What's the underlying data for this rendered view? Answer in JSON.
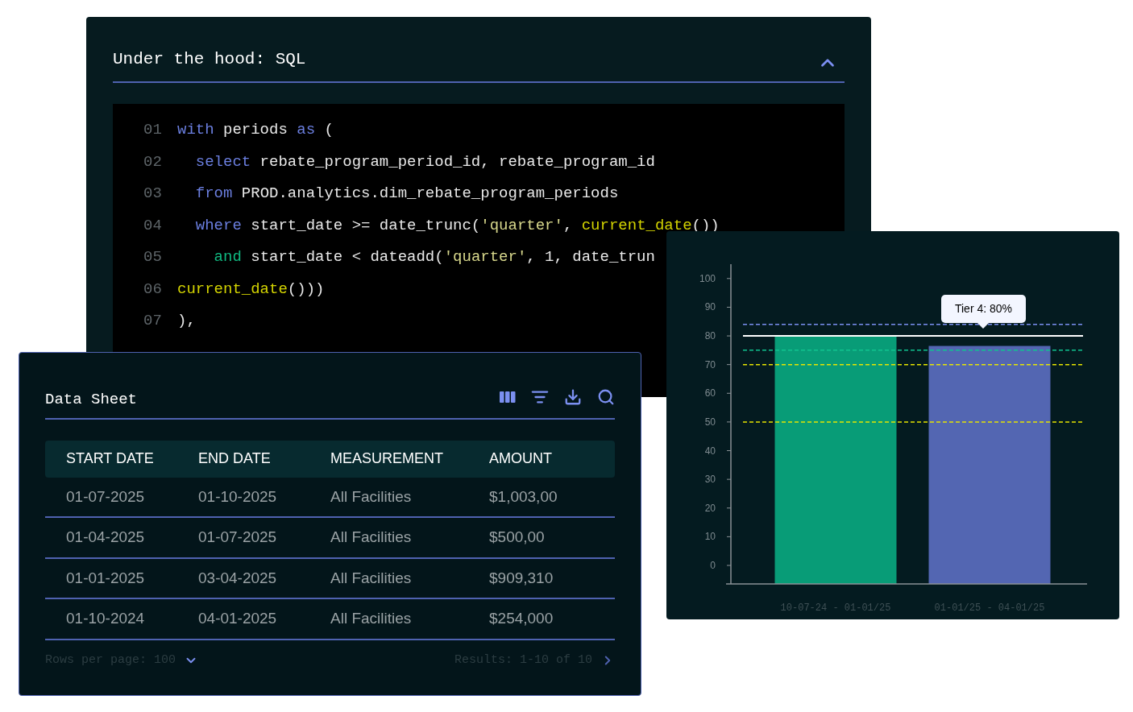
{
  "sql_panel": {
    "title": "Under the hood: SQL",
    "expanded": true,
    "lines": [
      {
        "number": "01",
        "tokens": [
          {
            "kind": "keyword",
            "text": "with"
          },
          {
            "kind": "plain",
            "text": " periods "
          },
          {
            "kind": "keyword",
            "text": "as"
          },
          {
            "kind": "plain",
            "text": " ("
          }
        ]
      },
      {
        "number": "02",
        "tokens": [
          {
            "kind": "keyword",
            "text": "  select"
          },
          {
            "kind": "plain",
            "text": " rebate_program_period_id, rebate_program_id"
          }
        ]
      },
      {
        "number": "03",
        "tokens": [
          {
            "kind": "keyword",
            "text": "  from"
          },
          {
            "kind": "plain",
            "text": " PROD.analytics.dim_rebate_program_periods"
          }
        ]
      },
      {
        "number": "04",
        "tokens": [
          {
            "kind": "keyword",
            "text": "  where"
          },
          {
            "kind": "plain",
            "text": " start_date >= date_trunc("
          },
          {
            "kind": "string",
            "text": "'quarter'"
          },
          {
            "kind": "plain",
            "text": ", "
          },
          {
            "kind": "function",
            "text": "current_date"
          },
          {
            "kind": "plain",
            "text": "())"
          }
        ]
      },
      {
        "number": "05",
        "tokens": [
          {
            "kind": "operator",
            "text": "    and"
          },
          {
            "kind": "plain",
            "text": " start_date < dateadd("
          },
          {
            "kind": "string",
            "text": "'quarter'"
          },
          {
            "kind": "plain",
            "text": ", 1, date_trun"
          }
        ]
      },
      {
        "number": "06",
        "tokens": [
          {
            "kind": "function",
            "text": "current_date"
          },
          {
            "kind": "plain",
            "text": "()))"
          }
        ]
      },
      {
        "number": "07",
        "tokens": [
          {
            "kind": "plain",
            "text": "),"
          }
        ]
      }
    ]
  },
  "chart_panel": {
    "tooltip": "Tier 4: 80%",
    "chart_data": {
      "type": "bar",
      "categories": [
        "10-07-24 - 01-01/25",
        "01-01/25 - 04-01/25"
      ],
      "series": [
        {
          "color": "#089c77",
          "values": [
            80,
            null
          ]
        },
        {
          "color": "#5366b2",
          "values": [
            null,
            76.5
          ]
        }
      ],
      "ylim": [
        0,
        105
      ],
      "yticks": [
        0,
        10,
        20,
        30,
        40,
        50,
        60,
        70,
        80,
        90,
        100
      ]
    }
  },
  "data_sheet": {
    "title": "Data Sheet",
    "columns": [
      "START DATE",
      "END DATE",
      "MEASUREMENT",
      "AMOUNT"
    ],
    "rows": [
      [
        "01-07-2025",
        "01-10-2025",
        "All Facilities",
        "$1,003,00"
      ],
      [
        "01-04-2025",
        "01-07-2025",
        "All Facilities",
        "$500,00"
      ],
      [
        "01-01-2025",
        "03-04-2025",
        "All Facilities",
        "$909,310"
      ],
      [
        "01-10-2024",
        "04-01-2025",
        "All Facilities",
        "$254,000"
      ]
    ],
    "rows_per_page": "Rows per page: 100",
    "results": "Results: 1-10 of 10"
  }
}
